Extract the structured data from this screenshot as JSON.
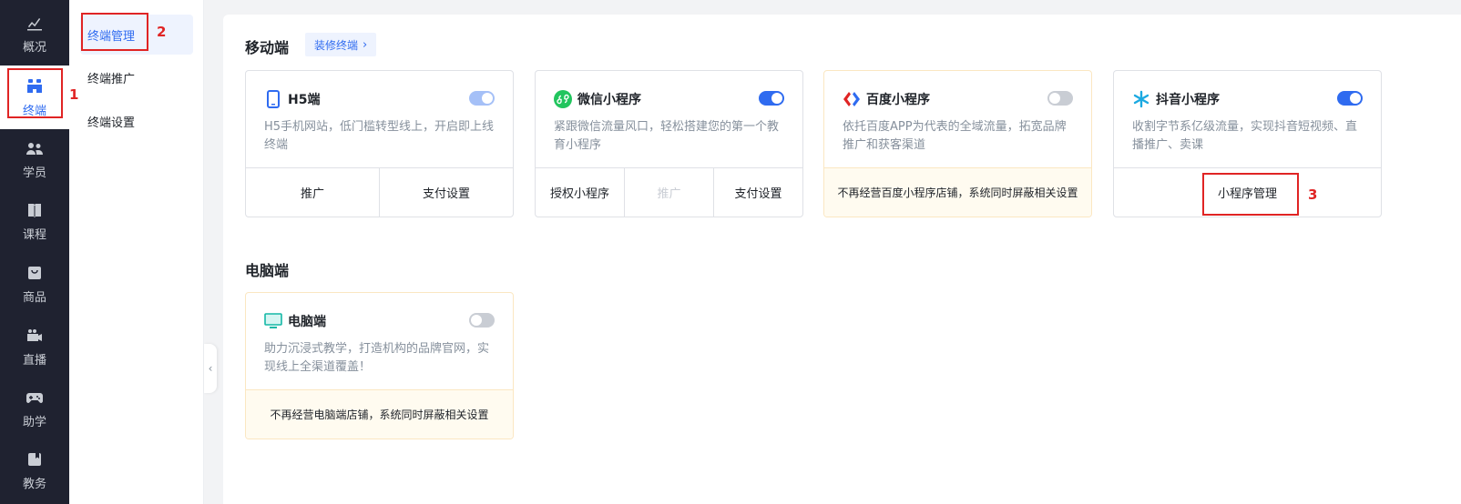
{
  "nav": {
    "items": [
      {
        "label": "概况",
        "icon": "chart-icon"
      },
      {
        "label": "终端",
        "icon": "terminal-icon"
      },
      {
        "label": "学员",
        "icon": "users-icon"
      },
      {
        "label": "课程",
        "icon": "book-icon"
      },
      {
        "label": "商品",
        "icon": "bag-icon"
      },
      {
        "label": "直播",
        "icon": "video-icon"
      },
      {
        "label": "助学",
        "icon": "gamepad-icon"
      },
      {
        "label": "教务",
        "icon": "clipboard-icon"
      }
    ],
    "active_index": 1
  },
  "subnav": {
    "items": [
      {
        "label": "终端管理"
      },
      {
        "label": "终端推广"
      },
      {
        "label": "终端设置"
      }
    ],
    "active_index": 0
  },
  "mobile": {
    "title": "移动端",
    "decor_button": "装修终端",
    "cards": [
      {
        "name": "H5端",
        "desc": "H5手机网站，低门槛转型线上，开启即上线终端",
        "toggle": "on-disabled",
        "actions": [
          "推广",
          "支付设置"
        ]
      },
      {
        "name": "微信小程序",
        "desc": "紧跟微信流量风口，轻松搭建您的第一个教育小程序",
        "toggle": "on",
        "actions": [
          "授权小程序",
          "推广",
          "支付设置"
        ]
      },
      {
        "name": "百度小程序",
        "desc": "依托百度APP为代表的全域流量，拓宽品牌推广和获客渠道",
        "toggle": "off",
        "notice": "不再经营百度小程序店铺，系统同时屏蔽相关设置"
      },
      {
        "name": "抖音小程序",
        "desc": "收割字节系亿级流量，实现抖音短视频、直播推广、卖课",
        "toggle": "on",
        "actions": [
          "小程序管理"
        ]
      }
    ]
  },
  "pc": {
    "title": "电脑端",
    "cards": [
      {
        "name": "电脑端",
        "desc": "助力沉浸式教学，打造机构的品牌官网，实现线上全渠道覆盖！",
        "toggle": "off",
        "notice": "不再经营电脑端店铺，系统同时屏蔽相关设置"
      }
    ]
  },
  "annotations": [
    "1",
    "2",
    "3"
  ],
  "colors": {
    "accent": "#2f6bf0",
    "nav_bg": "#1f2230",
    "annotation": "#e02424",
    "notice_bg": "#fffbf0"
  }
}
